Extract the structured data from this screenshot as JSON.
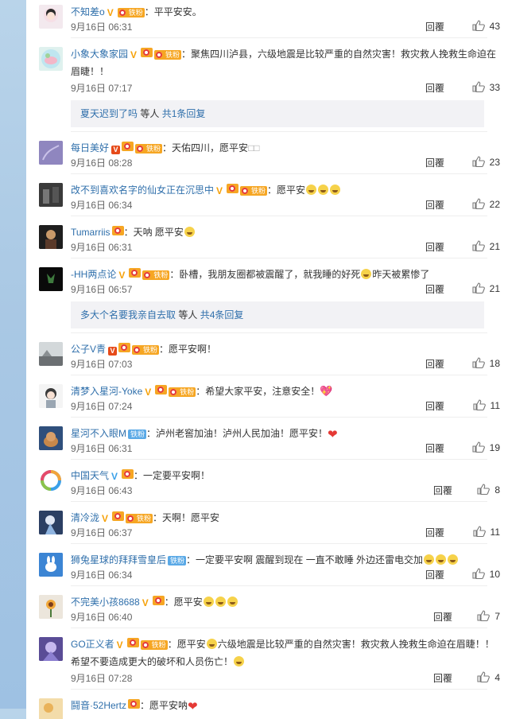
{
  "comments": [
    {
      "user": "不知差o",
      "text": "平平安安。",
      "time": "9月16日 06:31",
      "reply": "回覆",
      "likes": "43"
    },
    {
      "user": "小象大象家园",
      "text": "聚焦四川泸县，六级地震是比较严重的自然灾害！救灾救人挽救生命迫在眉睫！！",
      "time": "9月16日 07:17",
      "reply": "回覆",
      "likes": "33"
    },
    {
      "user": "每日美好",
      "text": "天佑四川，愿平安",
      "time": "9月16日 08:28",
      "reply": "回覆",
      "likes": "23"
    },
    {
      "user": "改不到喜欢名字的仙女正在沉思中",
      "text": "愿平安",
      "time": "9月16日 06:34",
      "reply": "回覆",
      "likes": "22"
    },
    {
      "user": "Tumarriis",
      "text": "天呐 愿平安",
      "time": "9月16日 06:31",
      "reply": "回覆",
      "likes": "21"
    },
    {
      "user": "-HH两点论",
      "text": "卧槽，我朋友圈都被震醒了，就我睡的好死",
      "text2": "昨天被累惨了",
      "time": "9月16日 06:57",
      "reply": "回覆",
      "likes": "21"
    },
    {
      "user": "公子V青",
      "text": "愿平安啊！",
      "time": "9月16日 07:03",
      "reply": "回覆",
      "likes": "18"
    },
    {
      "user": "清梦入星河-Yoke",
      "text": "希望大家平安，注意安全！",
      "time": "9月16日 07:24",
      "reply": "回覆",
      "likes": "11"
    },
    {
      "user": "星河不入眼M",
      "text": "泸州老窖加油！泸州人民加油！愿平安！",
      "time": "9月16日 06:31",
      "reply": "回覆",
      "likes": "19"
    },
    {
      "user": "中国天气",
      "text": "一定要平安啊！",
      "time": "9月16日 06:43",
      "reply": "回覆",
      "likes": "8"
    },
    {
      "user": "清冷泷",
      "text": "天啊！愿平安",
      "time": "9月16日 06:37",
      "reply": "回覆",
      "likes": "11"
    },
    {
      "user": "狮兔星球的拜拜雪皇后",
      "text": "一定要平安啊 震醒到现在 一直不敢睡 外边还雷电交加",
      "time": "9月16日 06:34",
      "reply": "回覆",
      "likes": "10"
    },
    {
      "user": "不完美小孩8688",
      "text": "愿平安",
      "time": "9月16日 06:40",
      "reply": "回覆",
      "likes": "7"
    },
    {
      "user": "GO正义者",
      "text": "愿平安",
      "text2": "六级地震是比较严重的自然灾害！救灾救人挽救生命迫在眉睫！！",
      "text3": "希望不要造成更大的破坏和人员伤亡！",
      "time": "9月16日 07:28",
      "reply": "回覆",
      "likes": "4"
    },
    {
      "user": "鬪音·52Hertz",
      "text": "愿平安呐"
    }
  ],
  "subreplies": [
    {
      "user": "夏天迟到了吗",
      "mid": " 等人 ",
      "count": "共1条回复"
    },
    {
      "user": "多大个名要我亲自去取",
      "mid": " 等人 ",
      "count": "共4条回复"
    }
  ],
  "badges": {
    "fan": "铁粉"
  },
  "colors": {
    "link": "#2f6fab",
    "gold_v": "#f6a20b",
    "fan_badge": "#f6a623"
  }
}
